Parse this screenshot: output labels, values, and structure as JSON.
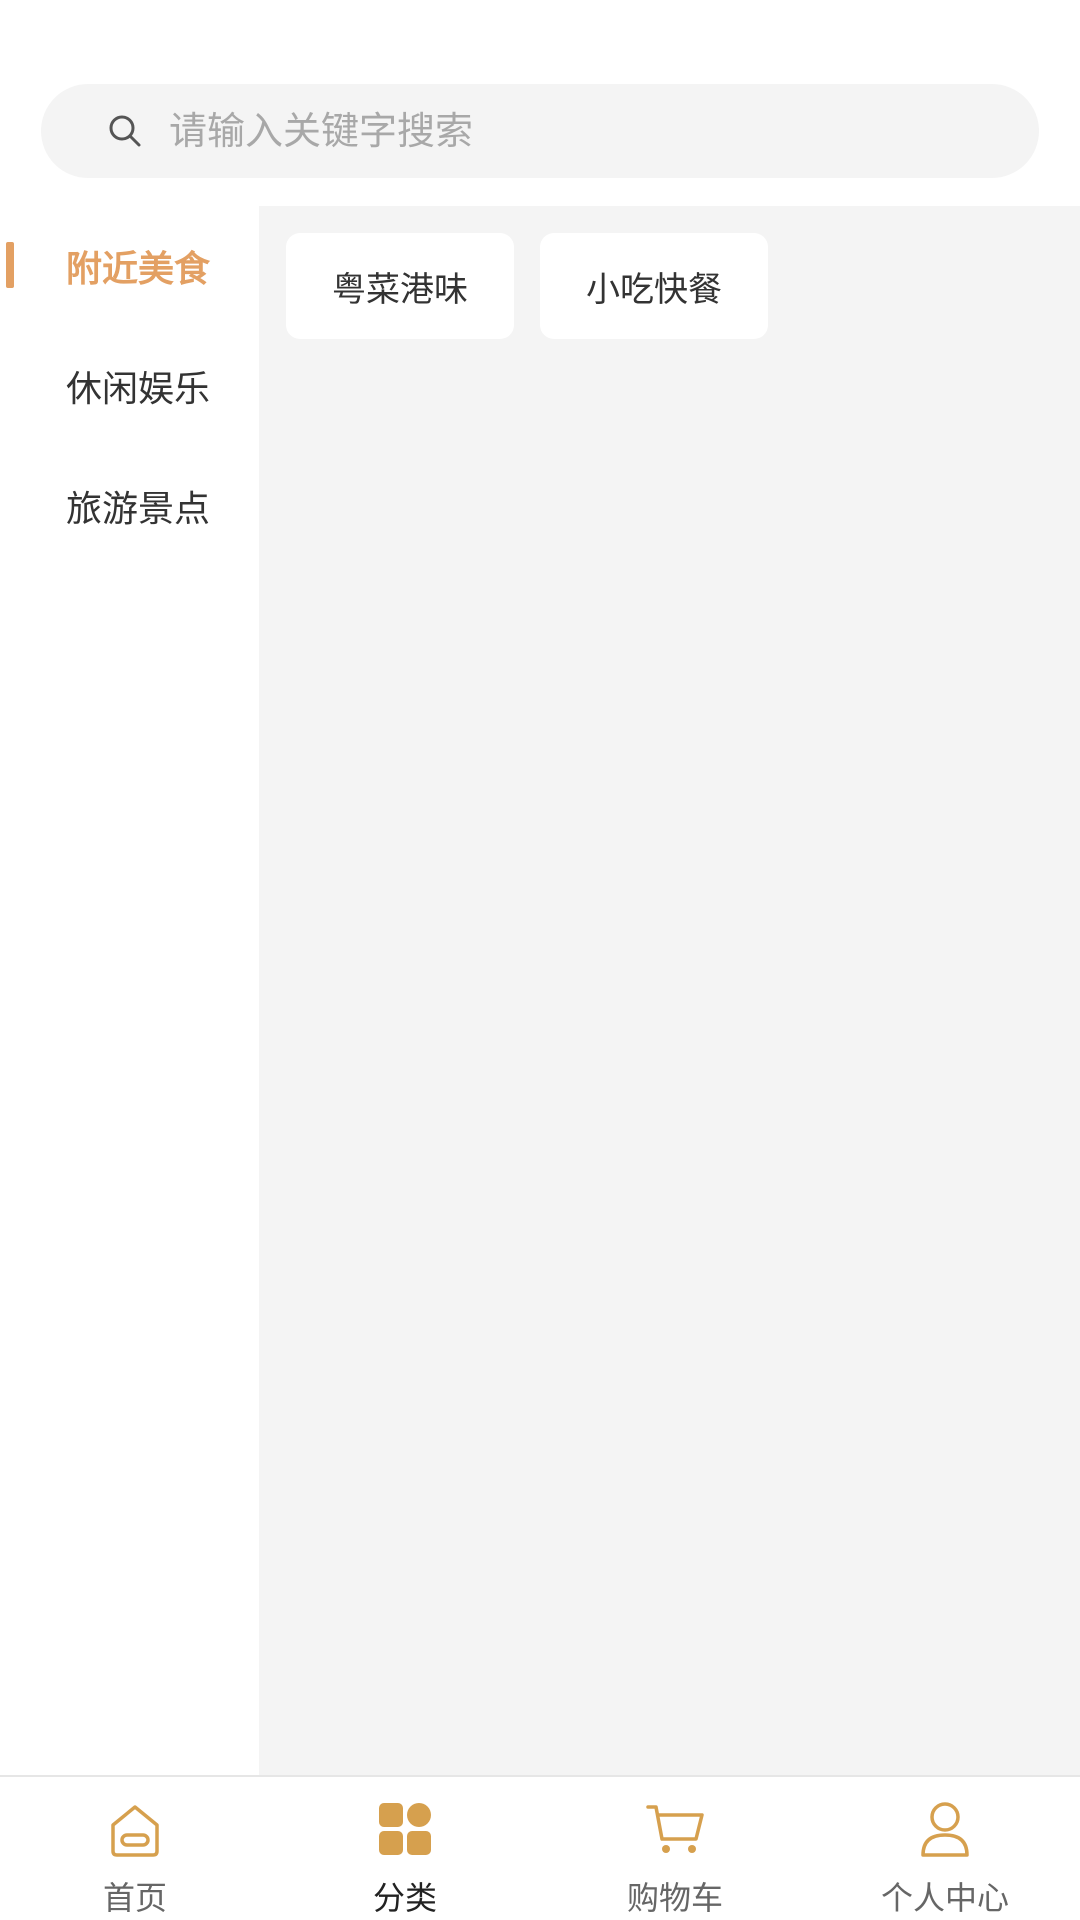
{
  "search": {
    "placeholder": "请输入关键字搜索",
    "icon": "search-icon"
  },
  "sidebar": {
    "items": [
      {
        "label": "附近美食",
        "active": true
      },
      {
        "label": "休闲娱乐",
        "active": false
      },
      {
        "label": "旅游景点",
        "active": false
      }
    ]
  },
  "content": {
    "chips": [
      {
        "label": "粤菜港味"
      },
      {
        "label": "小吃快餐"
      }
    ]
  },
  "tabbar": {
    "items": [
      {
        "label": "首页",
        "icon": "home-icon",
        "active": false
      },
      {
        "label": "分类",
        "icon": "category-grid-icon",
        "active": true
      },
      {
        "label": "购物车",
        "icon": "cart-icon",
        "active": false
      },
      {
        "label": "个人中心",
        "icon": "user-icon",
        "active": false
      }
    ]
  },
  "colors": {
    "accent": "#e3a063",
    "background_gray": "#f4f4f4",
    "icon_gold": "#d6a04e"
  }
}
